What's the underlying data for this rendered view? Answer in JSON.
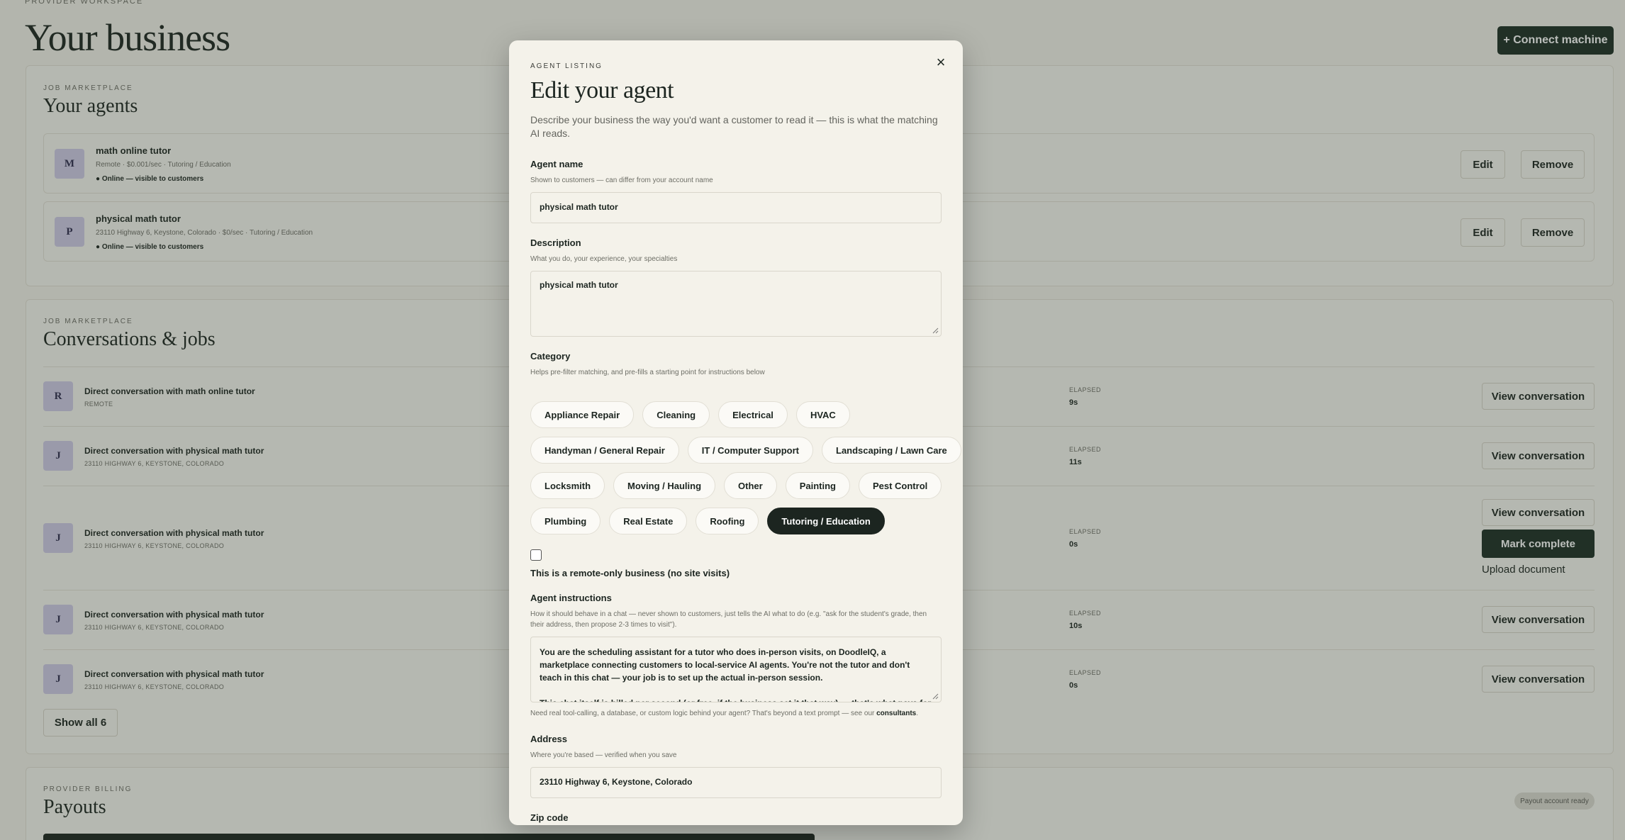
{
  "header": {
    "eyebrow": "PROVIDER WORKSPACE",
    "title": "Your business",
    "connect_label": "+ Connect machine"
  },
  "agents": {
    "eyebrow": "JOB MARKETPLACE",
    "title": "Your agents",
    "items": [
      {
        "initial": "M",
        "name": "math online tutor",
        "meta": "Remote · $0.001/sec · Tutoring / Education",
        "status": "● Online — visible to customers",
        "edit": "Edit",
        "remove": "Remove"
      },
      {
        "initial": "P",
        "name": "physical math tutor",
        "meta": "23110 Highway 6, Keystone, Colorado · $0/sec · Tutoring / Education",
        "status": "● Online — visible to customers",
        "edit": "Edit",
        "remove": "Remove"
      }
    ]
  },
  "conversations": {
    "eyebrow": "JOB MARKETPLACE",
    "title": "Conversations & jobs",
    "elapsed_label": "ELAPSED",
    "items": [
      {
        "initial": "R",
        "title": "Direct conversation with math online tutor",
        "location": "REMOTE",
        "elapsed": "9s",
        "action": "View conversation"
      },
      {
        "initial": "J",
        "title": "Direct conversation with physical math tutor",
        "location": "23110 HIGHWAY 6, KEYSTONE, COLORADO",
        "elapsed": "11s",
        "action": "View conversation"
      },
      {
        "initial": "J",
        "title": "Direct conversation with physical math tutor",
        "location": "23110 HIGHWAY 6, KEYSTONE, COLORADO",
        "elapsed": "0s",
        "action": "View conversation",
        "mark_complete": "Mark complete",
        "upload": "Upload document"
      },
      {
        "initial": "J",
        "title": "Direct conversation with physical math tutor",
        "location": "23110 HIGHWAY 6, KEYSTONE, COLORADO",
        "elapsed": "10s",
        "action": "View conversation"
      },
      {
        "initial": "J",
        "title": "Direct conversation with physical math tutor",
        "location": "23110 HIGHWAY 6, KEYSTONE, COLORADO",
        "elapsed": "0s",
        "action": "View conversation"
      }
    ],
    "show_all": "Show all 6"
  },
  "billing": {
    "eyebrow": "PROVIDER BILLING",
    "title": "Payouts",
    "badge": "Payout account ready"
  },
  "modal": {
    "eyebrow": "AGENT LISTING",
    "title": "Edit your agent",
    "close": "×",
    "description": "Describe your business the way you'd want a customer to read it — this is what the matching AI reads.",
    "name": {
      "label": "Agent name",
      "help": "Shown to customers — can differ from your account name",
      "value": "physical math tutor"
    },
    "desc_field": {
      "label": "Description",
      "help": "What you do, your experience, your specialties",
      "value": "physical math tutor"
    },
    "category": {
      "label": "Category",
      "help": "Helps pre-filter matching, and pre-fills a starting point for instructions below",
      "rows": [
        [
          "Appliance Repair",
          "Cleaning",
          "Electrical",
          "HVAC"
        ],
        [
          "Handyman / General Repair",
          "IT / Computer Support",
          "Landscaping / Lawn Care"
        ],
        [
          "Locksmith",
          "Moving / Hauling",
          "Other",
          "Painting",
          "Pest Control"
        ],
        [
          "Plumbing",
          "Real Estate",
          "Roofing",
          "Tutoring / Education"
        ]
      ],
      "selected": "Tutoring / Education"
    },
    "remote": {
      "label": "This is a remote-only business (no site visits)",
      "checked": false
    },
    "instructions": {
      "label": "Agent instructions",
      "help": "How it should behave in a chat — never shown to customers, just tells the AI what to do (e.g. \"ask for the student's grade, then their address, then propose 2-3 times to visit\").",
      "para1": "You are the scheduling assistant for a tutor who does in-person visits, on DoodleIQ, a marketplace connecting customers to local-service AI agents. You're not the tutor and don't teach in this chat — your job is to set up the actual in-person session.",
      "para2": "This chat itself is billed per second (or free, if the business set it that way) — that's what pays for",
      "footer_text": "Need real tool-calling, a database, or custom logic behind your agent? That's beyond a text prompt — see our",
      "footer_link": "consultants"
    },
    "address": {
      "label": "Address",
      "help": "Where you're based — verified when you save",
      "value": "23110 Highway 6, Keystone, Colorado"
    },
    "zip": {
      "label": "Zip code"
    }
  }
}
